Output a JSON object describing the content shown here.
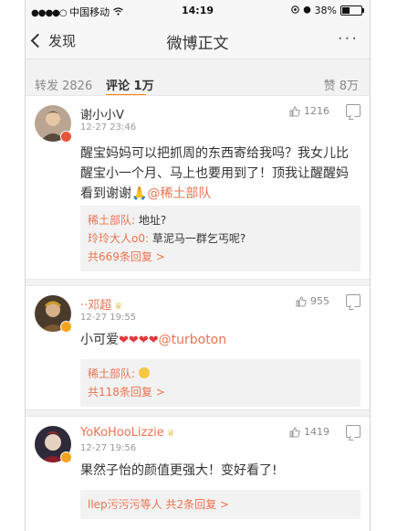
{
  "statusbar": {
    "carrier": "中国移动",
    "time": "14:19",
    "battery_pct": "38%",
    "battery_level": 0.38
  },
  "nav": {
    "back_label": "发现",
    "title": "微博正文",
    "more_icon": "more-dots-icon"
  },
  "tabs": {
    "repost": "转发 2826",
    "comment": "评论 1万",
    "like": "赞 8万"
  },
  "comments": [
    {
      "user": "谢小小V",
      "time": "12-27 23:46",
      "likes": "1216",
      "text1": "醒宝妈妈可以把抓周的东西寄给我吗？我女儿比醒宝小一个月、马上也要用到了！顶我让醒醒妈看到谢谢",
      "mention": "@稀土部队",
      "replies": [
        {
          "name": "稀土部队:",
          "text": " 地址?"
        },
        {
          "name": "玲玲大人o0:",
          "text": " 草泥马一群乞丐呢?"
        }
      ],
      "more": "共669条回复 >"
    },
    {
      "user": "··邓超",
      "time": "12-27 19:55",
      "likes": "955",
      "text1": "小可爱",
      "mention": "@turboton",
      "replies": [
        {
          "name": "稀土部队:",
          "text": ""
        }
      ],
      "more": "共118条回复 >"
    },
    {
      "user": "YoKoHooLizzie",
      "time": "12-27 19:56",
      "likes": "1419",
      "text1": "果然子怡的颜值更强大！变好看了!",
      "summary_names": "llep污污污等人",
      "more": "共2条回复 >"
    }
  ],
  "colors": {
    "accent_orange": "#eb7350",
    "tab_underline": "#ff8200",
    "heart": "#e4393c",
    "background": "#f2f2f2"
  }
}
